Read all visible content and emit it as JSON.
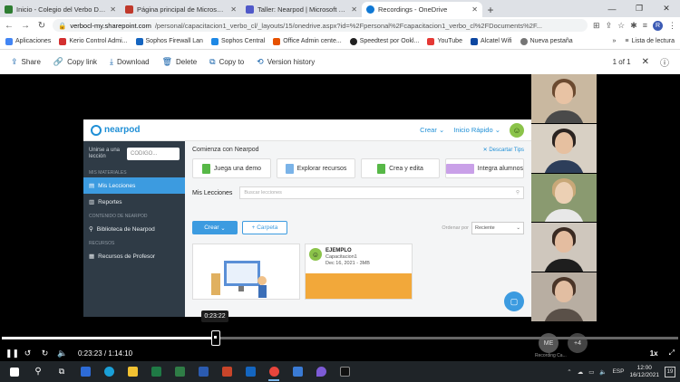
{
  "browser": {
    "tabs": [
      {
        "title": "Inicio - Colegio del Verbo Divino",
        "color": "#2e7d32",
        "active": false
      },
      {
        "title": "Página principal de Microsoft Of",
        "color": "#c0392b",
        "active": false
      },
      {
        "title": "Taller: Nearpod | Microsoft Teams",
        "color": "#5059c9",
        "active": false
      },
      {
        "title": "Recordings - OneDrive",
        "color": "#0f78d4",
        "active": true
      }
    ],
    "url_domain": "verbocl-my.sharepoint.com",
    "url_path": "/personal/capacitacion1_verbo_cl/_layouts/15/onedrive.aspx?id=%2Fpersonal%2Fcapacitacion1_verbo_cl%2FDocuments%2F...",
    "profile_initial": "R",
    "bookmarks": [
      {
        "label": "Aplicaciones",
        "color": "#4285f4"
      },
      {
        "label": "Kerio Control Admi...",
        "color": "#d32f2f"
      },
      {
        "label": "Sophos Firewall Lan",
        "color": "#1565c0"
      },
      {
        "label": "Sophos Central",
        "color": "#1e88e5"
      },
      {
        "label": "Office Admin cente...",
        "color": "#e65100"
      },
      {
        "label": "Speedtest por Ookl...",
        "color": "#212121"
      },
      {
        "label": "YouTube",
        "color": "#e53935"
      },
      {
        "label": "Alcatel Wifi",
        "color": "#0d47a1"
      },
      {
        "label": "Nueva pestaña",
        "color": "#757575"
      }
    ],
    "reading_list": "Lista de lectura",
    "more": "»"
  },
  "toolbar": {
    "share": "Share",
    "copy_link": "Copy link",
    "download": "Download",
    "delete": "Delete",
    "copy_to": "Copy to",
    "version_history": "Version history",
    "page_indicator": "1 of 1"
  },
  "nearpod": {
    "logo": "nearpod",
    "crear": "Crear",
    "inicio_rapido": "Inicio Rápido",
    "join_label": "Unirse a una lección",
    "code_placeholder": "CODIGO...",
    "section_mis": "MIS MATERIALES",
    "mis_lecciones": "Mis Lecciones",
    "reportes": "Reportes",
    "section_contenido": "CONTENIDO DE NEARPOD",
    "biblioteca": "Biblioteca de Nearpod",
    "section_recursos": "RECURSOS",
    "recursos_profesor": "Recursos de Profesor",
    "comienza": "Comienza con Nearpod",
    "descartar": "Descartar Tips",
    "act_demo": "Juega una demo",
    "act_explorar": "Explorar recursos",
    "act_crea": "Crea y edita",
    "act_integra": "Integra alumnos",
    "mis_lecciones_heading": "Mis Lecciones",
    "buscar": "Buscar lecciones",
    "btn_crear": "Crear",
    "btn_carpeta": "+ Carpeta",
    "ordenar": "Ordenar por",
    "reciente": "Reciente",
    "card_title": "EJEMPLO",
    "card_owner": "Capacitacion1",
    "card_meta": "Dec 16, 2021 - 3MB"
  },
  "player": {
    "tooltip_time": "0:23:22",
    "current_time": "0:23:23",
    "duration": "1:14:10",
    "separator": "/",
    "progress": 0.316,
    "speed": "1x"
  },
  "participants": {
    "avatar1": "ME",
    "avatar2": "+4",
    "avatar_label": "Recording Ca..."
  },
  "taskbar": {
    "language": "ESP",
    "time": "12:00",
    "date": "16/12/2021",
    "notifications": "19"
  }
}
